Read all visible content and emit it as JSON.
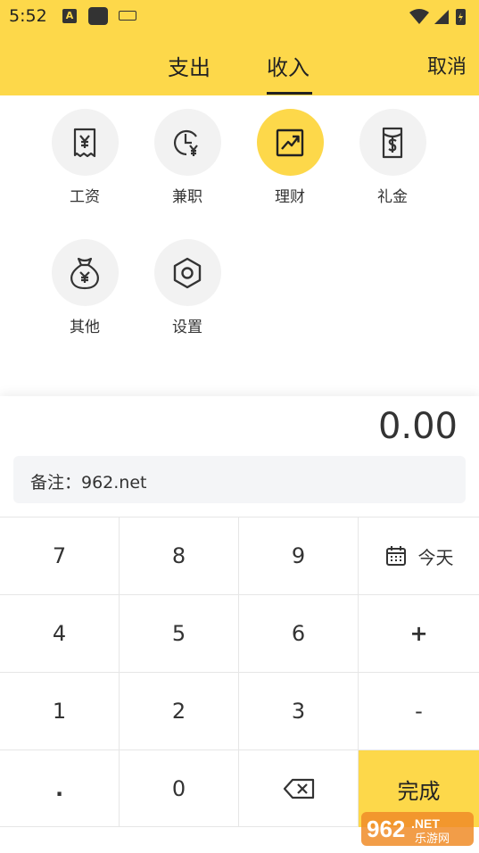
{
  "status": {
    "time": "5:52",
    "icons": [
      "a-notification-icon",
      "app-notification-icon",
      "keyboard-icon",
      "wifi-icon",
      "signal-icon",
      "battery-icon"
    ]
  },
  "tabs": {
    "expense": "支出",
    "income": "收入",
    "cancel": "取消"
  },
  "categories": [
    {
      "label": "工资",
      "icon": "receipt-yen-icon"
    },
    {
      "label": "兼职",
      "icon": "clock-yen-icon"
    },
    {
      "label": "理财",
      "icon": "trend-chart-icon",
      "active": true
    },
    {
      "label": "礼金",
      "icon": "dollar-envelope-icon"
    },
    {
      "label": "其他",
      "icon": "money-bag-icon"
    },
    {
      "label": "设置",
      "icon": "settings-hexagon-icon"
    }
  ],
  "amount": "0.00",
  "note": "备注：962.net",
  "keypad": {
    "row1": [
      "7",
      "8",
      "9"
    ],
    "row2": [
      "4",
      "5",
      "6"
    ],
    "row3": [
      "1",
      "2",
      "3"
    ],
    "dot": ".",
    "zero": "0",
    "today": "今天",
    "plus": "+",
    "minus": "-",
    "done": "完成"
  },
  "watermark": {
    "number": "962",
    "suffix": ".NET",
    "text": "乐游网"
  },
  "colors": {
    "accent": "#fdd84a",
    "text": "#333333",
    "icon_bg": "#f2f2f2"
  }
}
